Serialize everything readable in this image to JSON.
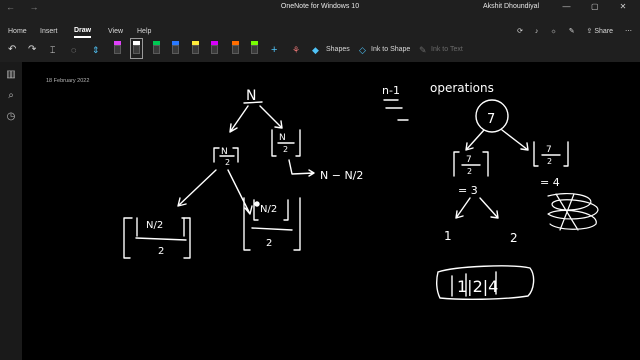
{
  "titlebar": {
    "back": "←",
    "forward": "→",
    "title": "OneNote for Windows 10",
    "user": "Akshit Dhoundiyal",
    "minimize": "—",
    "maximize": "▢",
    "close": "✕"
  },
  "menu": {
    "home": "Home",
    "insert": "Insert",
    "draw": "Draw",
    "view": "View",
    "help": "Help",
    "share": "Share"
  },
  "toolbar": {
    "shapes": "Shapes",
    "ink_to_shape": "Ink to Shape",
    "ink_to_text": "Ink to Text",
    "pen_colors": [
      "#e040fb",
      "#ffffff",
      "#00c853",
      "#2979ff",
      "#ffeb3b",
      "#d500f9",
      "#ff6d00",
      "#76ff03",
      "#00b0ff"
    ]
  },
  "page": {
    "date": "18 February 2022"
  },
  "ink": {
    "color": "#ffffff",
    "texts": {
      "root": "N",
      "half_top": "N",
      "half_bot": "2",
      "half2_top": "N",
      "half2_bot": "2",
      "formula": "N − N/2",
      "n_minus_1": "n-1",
      "operations": "operations",
      "seven": "7",
      "seven_a_top": "7",
      "seven_a_bot": "2",
      "seven_b_top": "7",
      "seven_b_bot": "2",
      "eq_a": "= 3",
      "eq_b": "= 4",
      "one": "1",
      "two": "2",
      "leaf_a": "N/2",
      "leaf_a_bot": "2",
      "leaf_b": "N/2",
      "leaf_b_bot": "2",
      "box": "1|2|4"
    }
  }
}
